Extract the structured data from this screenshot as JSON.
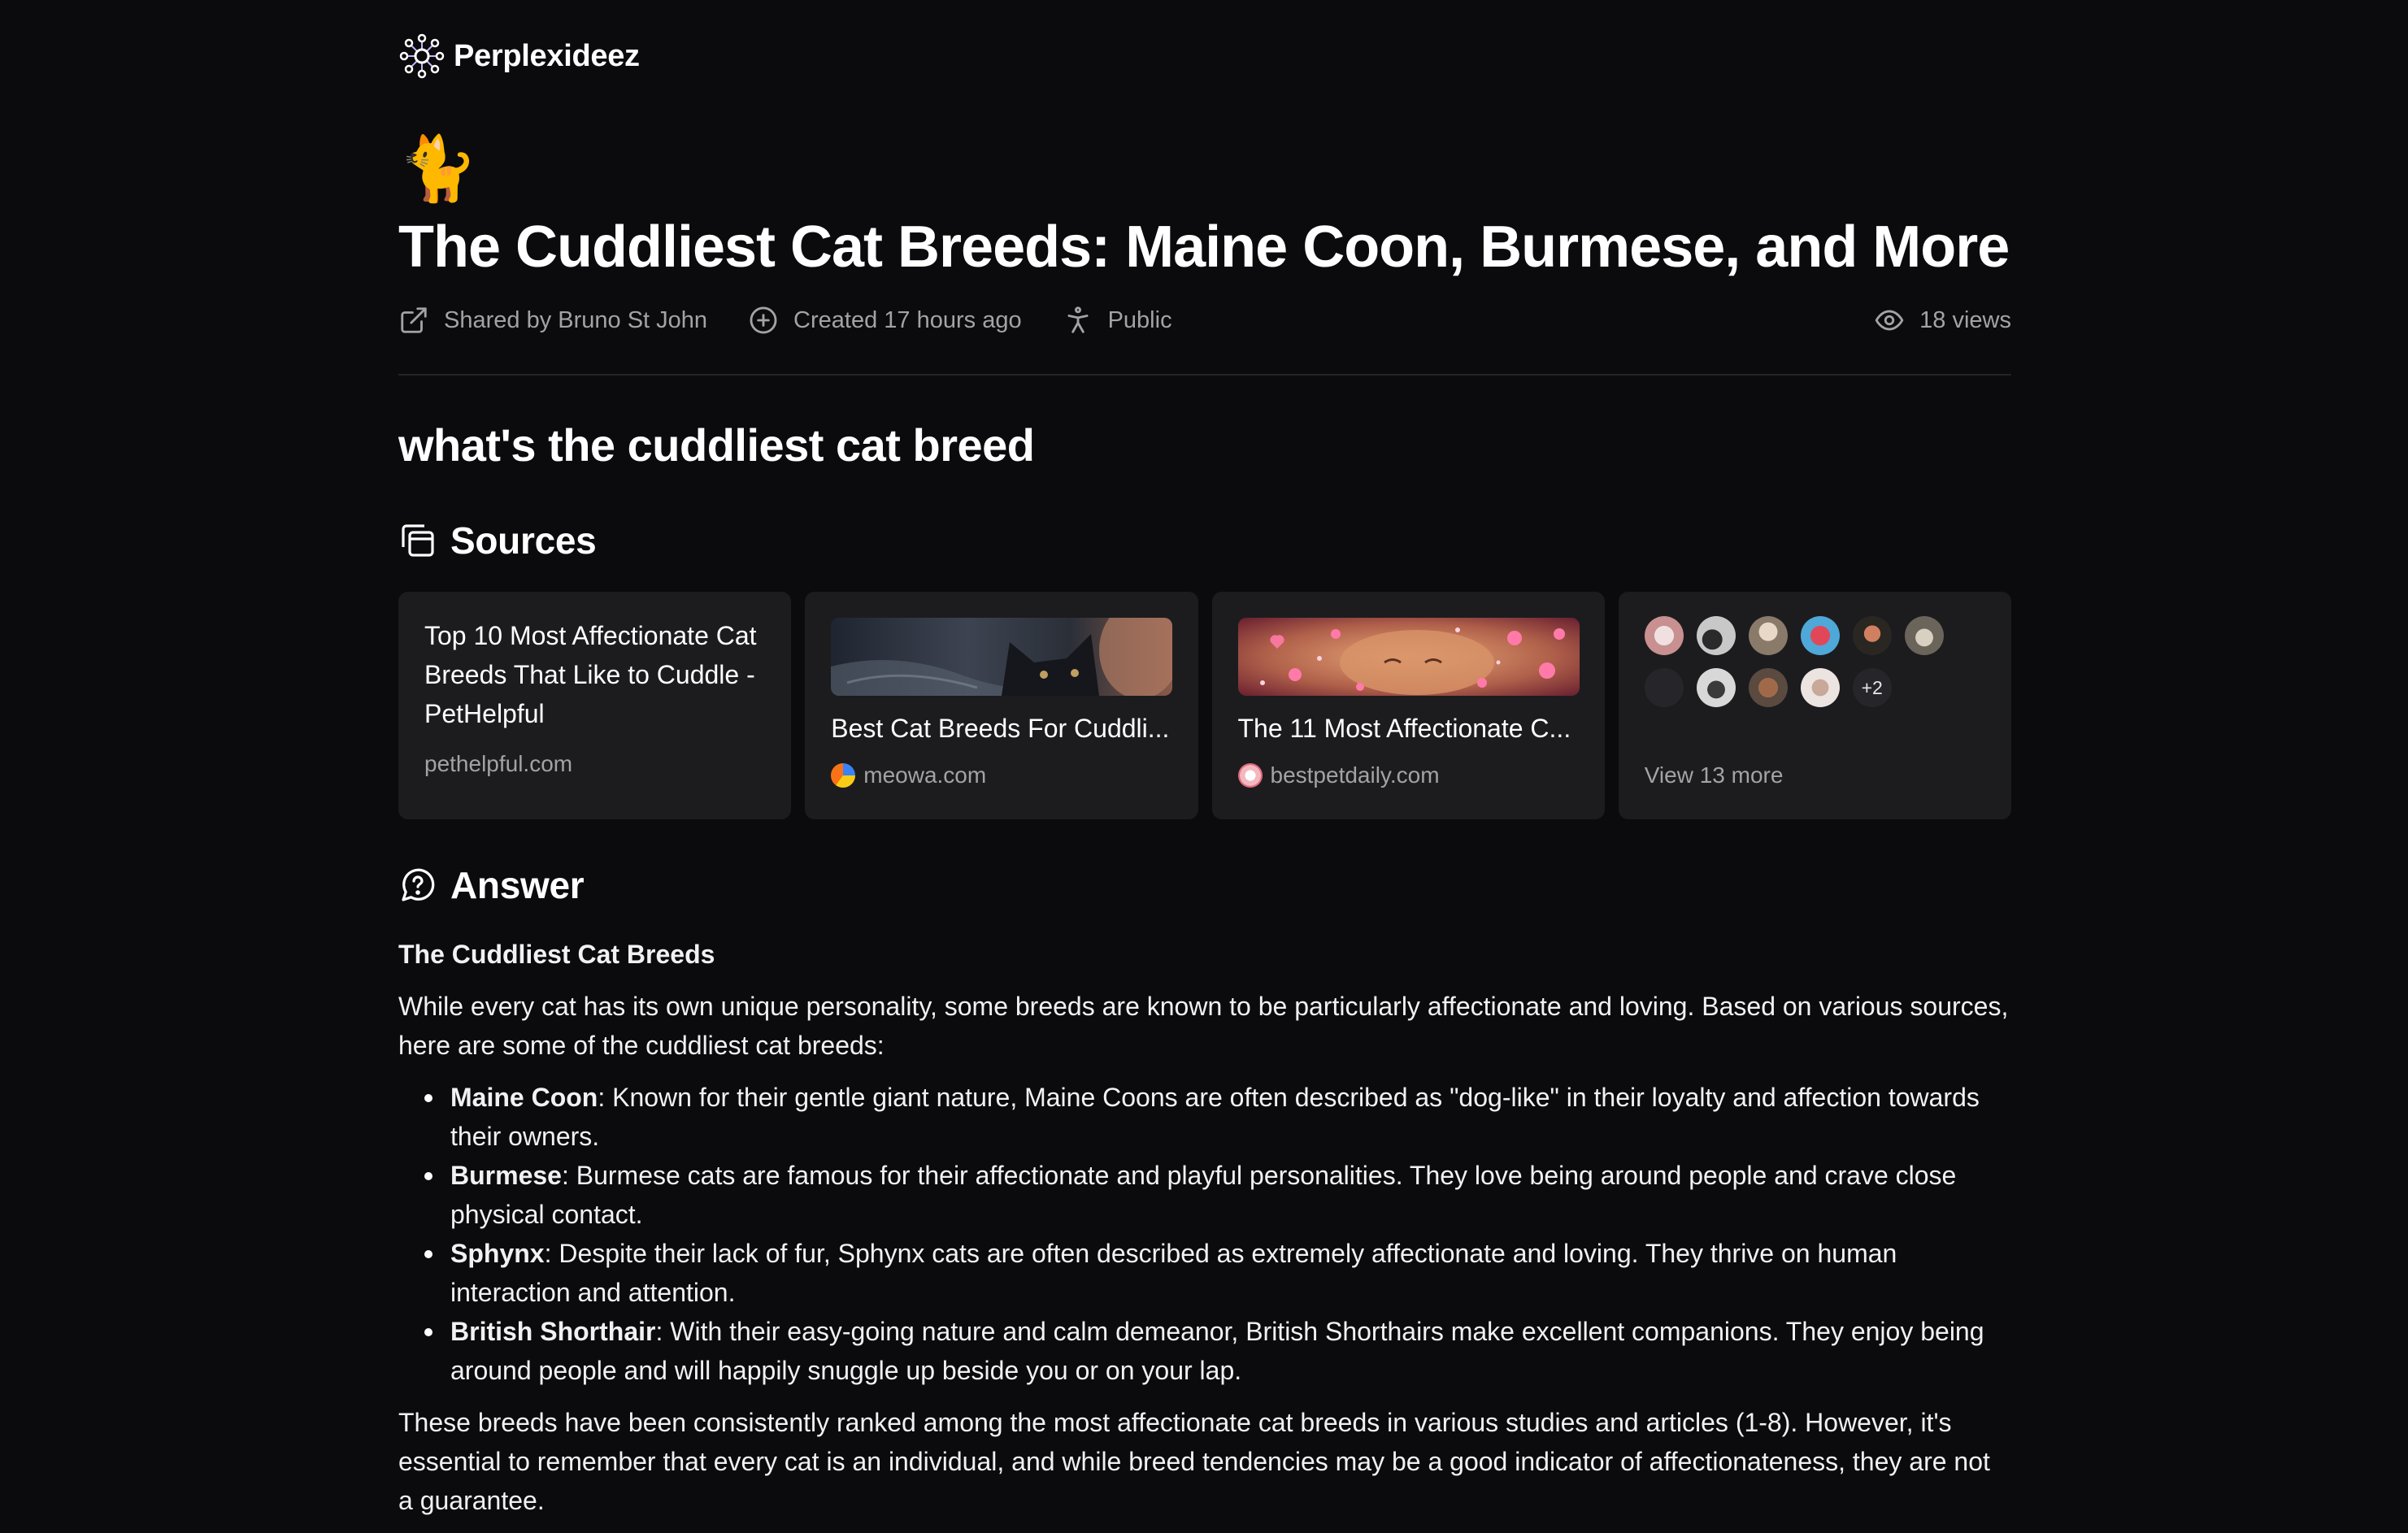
{
  "brand": {
    "name": "Perplexideez",
    "logo_icon": "constellation-logo-icon",
    "accent": "#c4b5fd"
  },
  "thread": {
    "emoji": "🐈",
    "title": "The Cuddliest Cat Breeds: Maine Coon, Burmese, and More",
    "meta": {
      "shared_by": "Shared by Bruno St John",
      "created": "Created 17 hours ago",
      "visibility": "Public",
      "views": "18 views"
    },
    "question": "what's the cuddliest cat breed"
  },
  "sources": {
    "heading": "Sources",
    "icon": "copy-icon",
    "cards": [
      {
        "title": "Top 10 Most Affectionate Cat Breeds That Like to Cuddle - PetHelpful",
        "domain": "pethelpful.com"
      },
      {
        "title": "Best Cat Breeds For Cuddli...",
        "domain": "meowa.com",
        "thumbnail": "cat-photo-thumbnail"
      },
      {
        "title": "The 11 Most Affectionate C...",
        "domain": "bestpetdaily.com",
        "thumbnail": "hearts-cat-thumbnail"
      }
    ],
    "more": {
      "extra_count": "+2",
      "label": "View 13 more"
    }
  },
  "answer": {
    "heading": "Answer",
    "icon": "chat-question-icon",
    "subheading": "The Cuddliest Cat Breeds",
    "intro": "While every cat has its own unique personality, some breeds are known to be particularly affectionate and loving. Based on various sources, here are some of the cuddliest cat breeds:",
    "breeds": [
      {
        "name": "Maine Coon",
        "text": ": Known for their gentle giant nature, Maine Coons are often described as \"dog-like\" in their loyalty and affection towards their owners."
      },
      {
        "name": "Burmese",
        "text": ": Burmese cats are famous for their affectionate and playful personalities. They love being around people and crave close physical contact."
      },
      {
        "name": "Sphynx",
        "text": ": Despite their lack of fur, Sphynx cats are often described as extremely affectionate and loving. They thrive on human interaction and attention."
      },
      {
        "name": "British Shorthair",
        "text": ": With their easy-going nature and calm demeanor, British Shorthairs make excellent companions. They enjoy being around people and will happily snuggle up beside you or on your lap."
      }
    ],
    "conclusion": "These breeds have been consistently ranked among the most affectionate cat breeds in various studies and articles (1-8). However, it's essential to remember that every cat is an individual, and while breed tendencies may be a good indicator of affectionateness, they are not a guarantee."
  }
}
